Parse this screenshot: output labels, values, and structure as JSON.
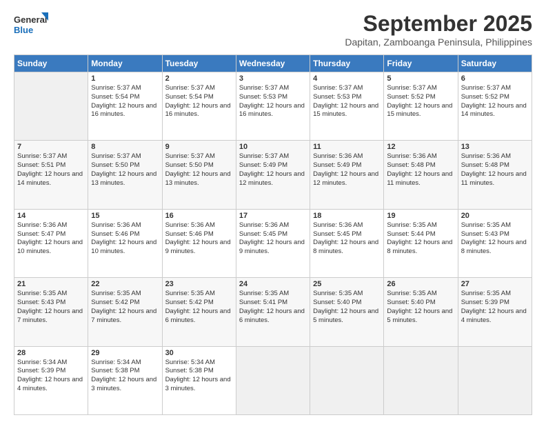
{
  "header": {
    "logo_line1": "General",
    "logo_line2": "Blue",
    "month": "September 2025",
    "location": "Dapitan, Zamboanga Peninsula, Philippines"
  },
  "weekdays": [
    "Sunday",
    "Monday",
    "Tuesday",
    "Wednesday",
    "Thursday",
    "Friday",
    "Saturday"
  ],
  "weeks": [
    [
      {
        "day": "",
        "sunrise": "",
        "sunset": "",
        "daylight": ""
      },
      {
        "day": "1",
        "sunrise": "Sunrise: 5:37 AM",
        "sunset": "Sunset: 5:54 PM",
        "daylight": "Daylight: 12 hours and 16 minutes."
      },
      {
        "day": "2",
        "sunrise": "Sunrise: 5:37 AM",
        "sunset": "Sunset: 5:54 PM",
        "daylight": "Daylight: 12 hours and 16 minutes."
      },
      {
        "day": "3",
        "sunrise": "Sunrise: 5:37 AM",
        "sunset": "Sunset: 5:53 PM",
        "daylight": "Daylight: 12 hours and 16 minutes."
      },
      {
        "day": "4",
        "sunrise": "Sunrise: 5:37 AM",
        "sunset": "Sunset: 5:53 PM",
        "daylight": "Daylight: 12 hours and 15 minutes."
      },
      {
        "day": "5",
        "sunrise": "Sunrise: 5:37 AM",
        "sunset": "Sunset: 5:52 PM",
        "daylight": "Daylight: 12 hours and 15 minutes."
      },
      {
        "day": "6",
        "sunrise": "Sunrise: 5:37 AM",
        "sunset": "Sunset: 5:52 PM",
        "daylight": "Daylight: 12 hours and 14 minutes."
      }
    ],
    [
      {
        "day": "7",
        "sunrise": "Sunrise: 5:37 AM",
        "sunset": "Sunset: 5:51 PM",
        "daylight": "Daylight: 12 hours and 14 minutes."
      },
      {
        "day": "8",
        "sunrise": "Sunrise: 5:37 AM",
        "sunset": "Sunset: 5:50 PM",
        "daylight": "Daylight: 12 hours and 13 minutes."
      },
      {
        "day": "9",
        "sunrise": "Sunrise: 5:37 AM",
        "sunset": "Sunset: 5:50 PM",
        "daylight": "Daylight: 12 hours and 13 minutes."
      },
      {
        "day": "10",
        "sunrise": "Sunrise: 5:37 AM",
        "sunset": "Sunset: 5:49 PM",
        "daylight": "Daylight: 12 hours and 12 minutes."
      },
      {
        "day": "11",
        "sunrise": "Sunrise: 5:36 AM",
        "sunset": "Sunset: 5:49 PM",
        "daylight": "Daylight: 12 hours and 12 minutes."
      },
      {
        "day": "12",
        "sunrise": "Sunrise: 5:36 AM",
        "sunset": "Sunset: 5:48 PM",
        "daylight": "Daylight: 12 hours and 11 minutes."
      },
      {
        "day": "13",
        "sunrise": "Sunrise: 5:36 AM",
        "sunset": "Sunset: 5:48 PM",
        "daylight": "Daylight: 12 hours and 11 minutes."
      }
    ],
    [
      {
        "day": "14",
        "sunrise": "Sunrise: 5:36 AM",
        "sunset": "Sunset: 5:47 PM",
        "daylight": "Daylight: 12 hours and 10 minutes."
      },
      {
        "day": "15",
        "sunrise": "Sunrise: 5:36 AM",
        "sunset": "Sunset: 5:46 PM",
        "daylight": "Daylight: 12 hours and 10 minutes."
      },
      {
        "day": "16",
        "sunrise": "Sunrise: 5:36 AM",
        "sunset": "Sunset: 5:46 PM",
        "daylight": "Daylight: 12 hours and 9 minutes."
      },
      {
        "day": "17",
        "sunrise": "Sunrise: 5:36 AM",
        "sunset": "Sunset: 5:45 PM",
        "daylight": "Daylight: 12 hours and 9 minutes."
      },
      {
        "day": "18",
        "sunrise": "Sunrise: 5:36 AM",
        "sunset": "Sunset: 5:45 PM",
        "daylight": "Daylight: 12 hours and 8 minutes."
      },
      {
        "day": "19",
        "sunrise": "Sunrise: 5:35 AM",
        "sunset": "Sunset: 5:44 PM",
        "daylight": "Daylight: 12 hours and 8 minutes."
      },
      {
        "day": "20",
        "sunrise": "Sunrise: 5:35 AM",
        "sunset": "Sunset: 5:43 PM",
        "daylight": "Daylight: 12 hours and 8 minutes."
      }
    ],
    [
      {
        "day": "21",
        "sunrise": "Sunrise: 5:35 AM",
        "sunset": "Sunset: 5:43 PM",
        "daylight": "Daylight: 12 hours and 7 minutes."
      },
      {
        "day": "22",
        "sunrise": "Sunrise: 5:35 AM",
        "sunset": "Sunset: 5:42 PM",
        "daylight": "Daylight: 12 hours and 7 minutes."
      },
      {
        "day": "23",
        "sunrise": "Sunrise: 5:35 AM",
        "sunset": "Sunset: 5:42 PM",
        "daylight": "Daylight: 12 hours and 6 minutes."
      },
      {
        "day": "24",
        "sunrise": "Sunrise: 5:35 AM",
        "sunset": "Sunset: 5:41 PM",
        "daylight": "Daylight: 12 hours and 6 minutes."
      },
      {
        "day": "25",
        "sunrise": "Sunrise: 5:35 AM",
        "sunset": "Sunset: 5:40 PM",
        "daylight": "Daylight: 12 hours and 5 minutes."
      },
      {
        "day": "26",
        "sunrise": "Sunrise: 5:35 AM",
        "sunset": "Sunset: 5:40 PM",
        "daylight": "Daylight: 12 hours and 5 minutes."
      },
      {
        "day": "27",
        "sunrise": "Sunrise: 5:35 AM",
        "sunset": "Sunset: 5:39 PM",
        "daylight": "Daylight: 12 hours and 4 minutes."
      }
    ],
    [
      {
        "day": "28",
        "sunrise": "Sunrise: 5:34 AM",
        "sunset": "Sunset: 5:39 PM",
        "daylight": "Daylight: 12 hours and 4 minutes."
      },
      {
        "day": "29",
        "sunrise": "Sunrise: 5:34 AM",
        "sunset": "Sunset: 5:38 PM",
        "daylight": "Daylight: 12 hours and 3 minutes."
      },
      {
        "day": "30",
        "sunrise": "Sunrise: 5:34 AM",
        "sunset": "Sunset: 5:38 PM",
        "daylight": "Daylight: 12 hours and 3 minutes."
      },
      {
        "day": "",
        "sunrise": "",
        "sunset": "",
        "daylight": ""
      },
      {
        "day": "",
        "sunrise": "",
        "sunset": "",
        "daylight": ""
      },
      {
        "day": "",
        "sunrise": "",
        "sunset": "",
        "daylight": ""
      },
      {
        "day": "",
        "sunrise": "",
        "sunset": "",
        "daylight": ""
      }
    ]
  ]
}
